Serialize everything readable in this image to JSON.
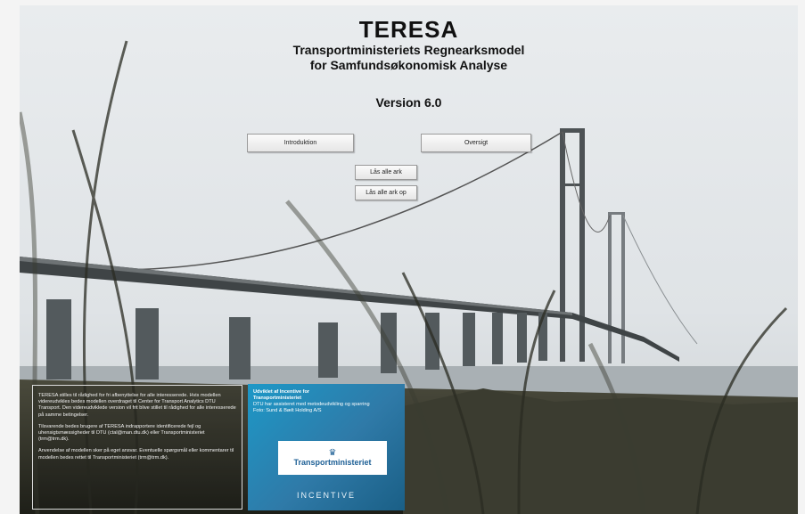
{
  "header": {
    "title": "TERESA",
    "subtitle_line1": "Transportministeriets Regnearksmodel",
    "subtitle_line2": "for Samfundsøkonomisk Analyse",
    "version": "Version 6.0"
  },
  "buttons": {
    "introduktion": "Introduktion",
    "oversigt": "Oversigt",
    "lock_all": "Lås alle ark",
    "unlock_all": "Lås alle ark op"
  },
  "info": {
    "p1": "TERESA stilles til rådighed for fri afbenyttelse for alle interesserede. Hvis modellen videreudvikles bedes modellen overdraget til Center for Transport Analytics DTU Transport. Den videreudviklede version vil frit blive stillet til rådighed for alle interesserede på samme betingelser.",
    "p2": "Tilsvarende bedes brugere af TERESA indrapportere identificerede fejl og uhensigtsmæssigheder til DTU (ctal@man.dtu.dk) eller Transportministeriet (trm@trm.dk).",
    "p3": "Anvendelse af modellen sker på eget ansvar. Eventuelle spørgsmål eller kommentarer til modellen bedes rettet til Transportministeriet (trm@trm.dk)."
  },
  "partner": {
    "heading_line1": "Udviklet af Incentive for",
    "heading_line2": "Transportministeriet",
    "line3": "DTU har assisteret med metodeudvikling og sparring",
    "photo_credit": "Foto: Sund & Bælt Holding A/S",
    "ministry_logo_text": "Transportministeriet",
    "incentive_logo_text": "INCENTIVE"
  },
  "colors": {
    "partner_blue": "#1d98c7",
    "ministry_blue": "#1c5f95"
  }
}
